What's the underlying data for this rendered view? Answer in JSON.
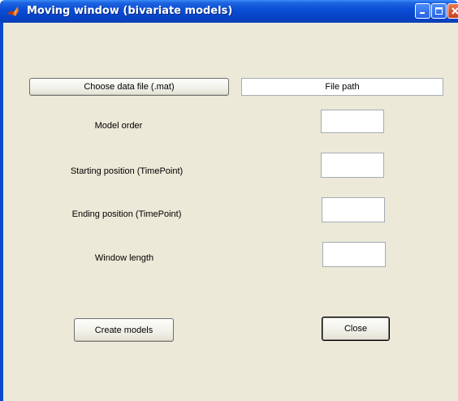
{
  "window": {
    "title": "Moving window (bivariate models)",
    "controls": {
      "minimize_icon": "minimize-icon",
      "maximize_icon": "maximize-icon",
      "close_icon": "close-icon"
    }
  },
  "colors": {
    "titlebar": "#0a4fd6",
    "client_background": "#ece9d8",
    "field_background": "#ffffff"
  },
  "file": {
    "choose_button_label": "Choose data file (.mat)",
    "path_value": "File path"
  },
  "parameters": {
    "model_order": {
      "label": "Model order",
      "value": ""
    },
    "starting_position": {
      "label": "Starting position (TimePoint)",
      "value": ""
    },
    "ending_position": {
      "label": "Ending position (TimePoint)",
      "value": ""
    },
    "window_length": {
      "label": "Window length",
      "value": ""
    }
  },
  "actions": {
    "create_models_label": "Create models",
    "close_label": "Close"
  }
}
